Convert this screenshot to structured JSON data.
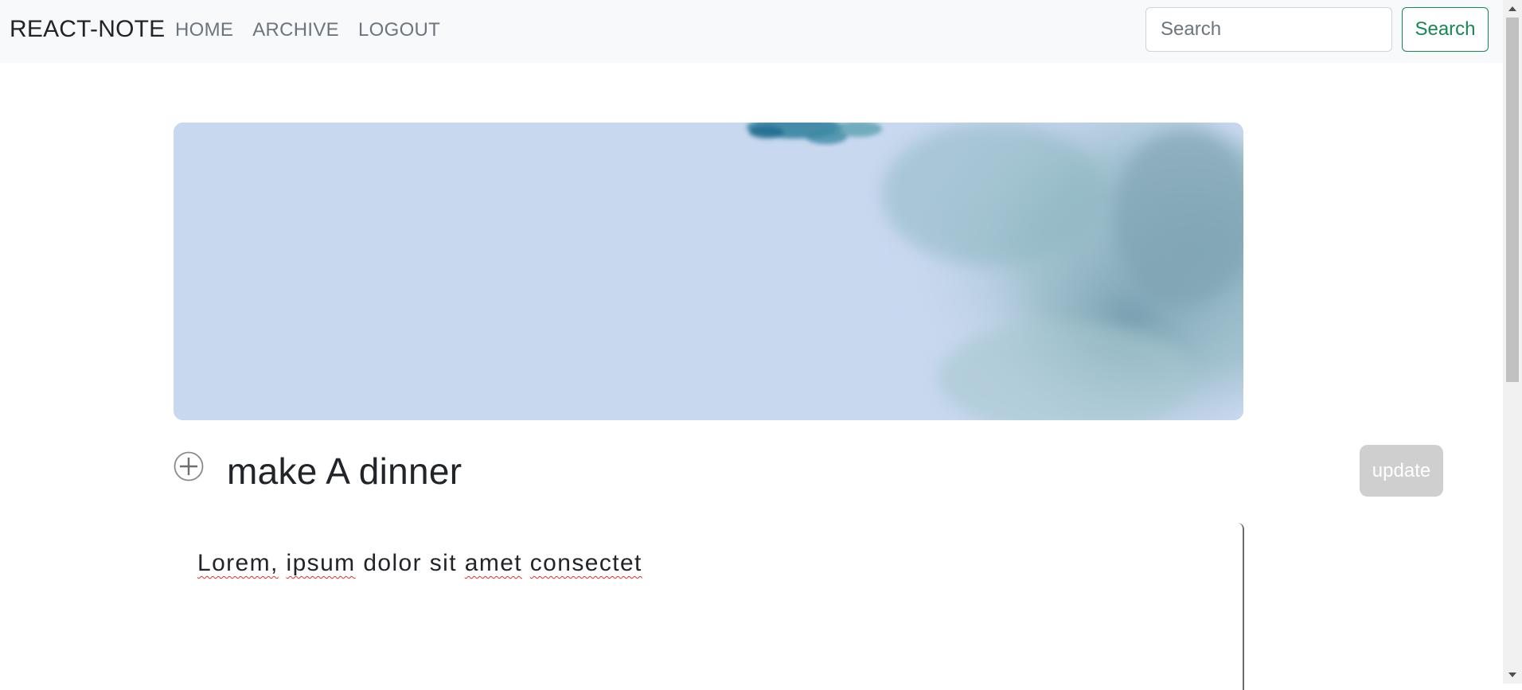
{
  "navbar": {
    "brand": "REACT-NOTE",
    "links": [
      "HOME",
      "ARCHIVE",
      "LOGOUT"
    ],
    "search_placeholder": "Search",
    "search_value": "",
    "search_button": "Search"
  },
  "note": {
    "title": "make A dinner",
    "update_label": "update",
    "body_words": [
      "Lorem,",
      "ipsum",
      "dolor",
      "sit",
      "amet",
      "consectet"
    ]
  },
  "colors": {
    "navbar_bg": "#f8f9fa",
    "accent_green": "#198754",
    "update_disabled": "#cfcfcf",
    "cover_sky": "#c8d8ef",
    "cover_foliage": "#8fb3bf"
  },
  "icons": {
    "add": "plus-circle-icon"
  }
}
